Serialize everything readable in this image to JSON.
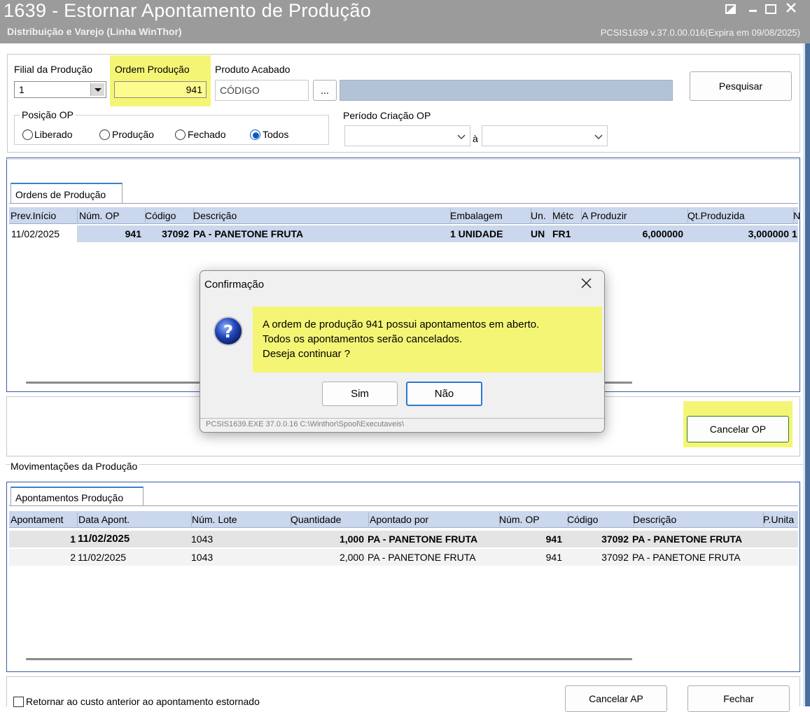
{
  "window": {
    "title": "1639 - Estornar Apontamento de Produção",
    "subtitle": "Distribuição e Varejo (Linha WinThor)",
    "version": "PCSIS1639  v.37.0.00.016(Expira em 09/08/2025)"
  },
  "filters": {
    "filial_label": "Filial da Produção",
    "filial_value": "1",
    "ordem_label": "Ordem Produção",
    "ordem_value": "941",
    "produto_label": "Produto Acabado",
    "produto_placeholder": "CÓDIGO",
    "ellipsis": "...",
    "search_button": "Pesquisar",
    "posicao_label": "Posição OP",
    "radios": [
      "Liberado",
      "Produção",
      "Fechado",
      "Todos"
    ],
    "selected_radio": "Todos",
    "periodo_label": "Período Criação OP",
    "periodo_sep": "à"
  },
  "ordens": {
    "tab": "Ordens de Produção",
    "columns": [
      "Prev.Início",
      "Núm. OP",
      "Código",
      "Descrição",
      "Embalagem",
      "Un.",
      "Métc",
      "A Produzir",
      "Qt.Produzida",
      "N"
    ],
    "rows": [
      [
        "11/02/2025",
        "941",
        "37092",
        "PA - PANETONE FRUTA",
        "1 UNIDADE",
        "UN",
        "FR1",
        "6,000000",
        "3,000000",
        "1"
      ]
    ]
  },
  "cancel_op_button": "Cancelar OP",
  "movimentacoes": {
    "group_label": "Movimentações da Produção",
    "tab": "Apontamentos Produção",
    "columns": [
      "Apontament",
      "Data Apont.",
      "Núm. Lote",
      "Quantidade",
      "Apontado por",
      "Núm. OP",
      "Código",
      "Descrição",
      "P.Unita"
    ],
    "rows": [
      [
        "1",
        "11/02/2025",
        "1043",
        "1,000",
        "PA - PANETONE FRUTA",
        "941",
        "37092",
        "PA - PANETONE FRUTA",
        ""
      ],
      [
        "2",
        "11/02/2025",
        "1043",
        "2,000",
        "PA - PANETONE FRUTA",
        "941",
        "37092",
        "PA - PANETONE FRUTA",
        ""
      ]
    ]
  },
  "footer": {
    "checkbox_label": "Retornar ao custo anterior ao apontamento estornado",
    "cancel_ap_button": "Cancelar AP",
    "close_button": "Fechar"
  },
  "dialog": {
    "title": "Confirmação",
    "close": "✕",
    "line1": "A ordem de produção 941 possui apontamentos em aberto.",
    "line2": "Todos os apontamentos serão cancelados.",
    "line3": "Deseja continuar ?",
    "yes": "Sim",
    "no": "Não",
    "status": "PCSIS1639.EXE 37.0.0.16 C:\\Winthor\\Spool\\Executaveis\\"
  },
  "colors": {
    "titlebar": "#9b9b9b",
    "highlight": "#f5f575",
    "grid_header": "#cad7ec",
    "selected_row": "#e4e4e4",
    "accent": "#0a59c2"
  }
}
